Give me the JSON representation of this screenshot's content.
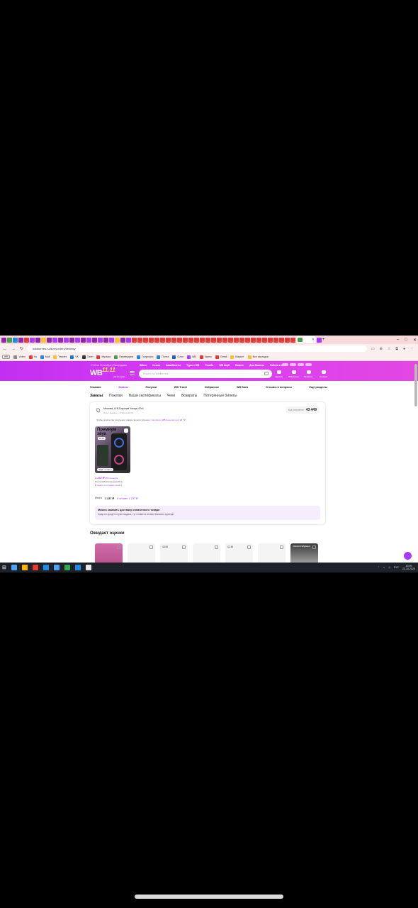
{
  "browser": {
    "url": "wildberries.ru/lk/myorders/delivery",
    "bookmarks": [
      {
        "label": "Video",
        "color": "#888888"
      },
      {
        "label": "Ya",
        "color": "#e53935"
      },
      {
        "label": "Mail",
        "color": "#1e88e5"
      },
      {
        "label": "Yandex",
        "color": "#fbc02d"
      },
      {
        "label": "VK",
        "color": "#1976d2"
      },
      {
        "label": "Dzen",
        "color": "#333333"
      },
      {
        "label": "Музыка",
        "color": "#e53935"
      },
      {
        "label": "Переводчик",
        "color": "#43a047"
      },
      {
        "label": "Госуслуги",
        "color": "#1e88e5"
      },
      {
        "label": "Почта",
        "color": "#1e88e5"
      },
      {
        "label": "Ozon",
        "color": "#1565c0"
      },
      {
        "label": "WB",
        "color": "#a73afd"
      },
      {
        "label": "Карты",
        "color": "#e53935"
      },
      {
        "label": "Gmail",
        "color": "#e53935"
      },
      {
        "label": "Маркет",
        "color": "#fbc02d"
      },
      {
        "label": "Все закладки",
        "color": "#fbc02d"
      }
    ],
    "tab_colors": [
      "#8e24aa",
      "#43a047",
      "#1e88e5",
      "#8e24aa",
      "#e53935",
      "#a73afd",
      "#8e24aa",
      "#fbc02d",
      "#8e24aa",
      "#a73afd",
      "#8e24aa",
      "#a73afd",
      "#8e24aa",
      "#a73afd",
      "#8e24aa",
      "#a73afd",
      "#8e24aa",
      "#a73afd",
      "#8e24aa",
      "#a73afd",
      "#fbc02d",
      "#8e24aa",
      "#a73afd",
      "#e53935",
      "#e53935",
      "#e53935",
      "#e53935",
      "#e53935",
      "#e53935",
      "#e53935",
      "#e53935",
      "#e53935",
      "#e53935",
      "#e53935",
      "#e53935",
      "#e53935",
      "#e53935",
      "#e53935",
      "#e53935",
      "#e53935",
      "#e53935",
      "#e53935",
      "#e53935",
      "#e53935",
      "#e53935",
      "#e53935",
      "#e53935",
      "#e53935",
      "#e53935",
      "#e53935",
      "#e53935",
      "#e53935",
      "#43a047",
      "#a73afd"
    ]
  },
  "site": {
    "promo": "С 10 по 13 ноября | Распродажа",
    "logo": "WB",
    "logo_badge": "11.11",
    "logo_sub": "распродажа",
    "search_placeholder": "Искать на Wildberries",
    "top_links": [
      "Wibes",
      "Отзыв",
      "Авиабилеты",
      "Туры с WB",
      "Релейс",
      "WB Клуб",
      "Бизнес",
      "Для бизнеса",
      "Работа в WB"
    ],
    "header_icons": [
      {
        "label": "Адреса",
        "icon": "pin-icon"
      },
      {
        "label": "Избранное",
        "icon": "heart-icon"
      },
      {
        "label": "Профиль",
        "icon": "user-icon"
      },
      {
        "label": "Корзина",
        "icon": "cart-icon"
      }
    ]
  },
  "subnav": [
    "Главная",
    "Заказы",
    "Покупки",
    "WB Travel",
    "Избранное",
    "WB Банк",
    "Отзывы и вопросы",
    "Ещё разделы"
  ],
  "subnav_active": "Заказы",
  "tabs": [
    "Заказы",
    "Покупки",
    "Ваши сертификаты",
    "Чеки",
    "Возвраты",
    "Потерянные билеты"
  ],
  "order": {
    "address": "Москва, 8-Я Горская Улица 47к1",
    "address_sub": "Пункт выдачи с 10:00 до 22:00",
    "code_label": "Код получения",
    "code": "43 449",
    "notice": "Чтобы оплата при получении товара прошла успешно,",
    "notice_link": "пополните WB Кошелёк на 1 237 ₽",
    "product_title_1": "Премиум",
    "product_title_2": "звук",
    "product_tag": "20 Вт",
    "product_status": "Ждёт оплаты",
    "price": "1 237 ₽",
    "price_old": "Wb кошелёк",
    "product_name": "Колонка Беспроводная Блю..",
    "product_link": "В пункте и отправят оплату",
    "total_label": "Итого",
    "total_value": "1 237 ₽",
    "pay_label": "К оплате 1 237 ₽",
    "info_title": "Можно заказать доставку оплаченного товара",
    "info_text": "Когда он придёт в пункт выдачи, тут появится кнопка «Вызвать курьера»"
  },
  "awaiting_title": "Ожидает оценки",
  "review_cards": [
    {
      "size": "",
      "style": "pink"
    },
    {
      "size": "",
      "style": "plain"
    },
    {
      "size": "42/46",
      "style": "plain"
    },
    {
      "size": "",
      "style": "plain"
    },
    {
      "size": "42-46",
      "style": "plain"
    },
    {
      "size": "",
      "style": "plain"
    },
    {
      "size": "ОМБРАПРЕЙДМЕНТ",
      "style": "dark"
    }
  ],
  "taskbar": {
    "time": "19:59",
    "date": "23.10.2025",
    "lang": "РУС",
    "apps": [
      "#4fa3f7",
      "#f4b400",
      "#e53935",
      "#1e88e5",
      "#4fa3f7",
      "#34a853",
      "#1e88e5",
      "#e8e8e8"
    ]
  }
}
